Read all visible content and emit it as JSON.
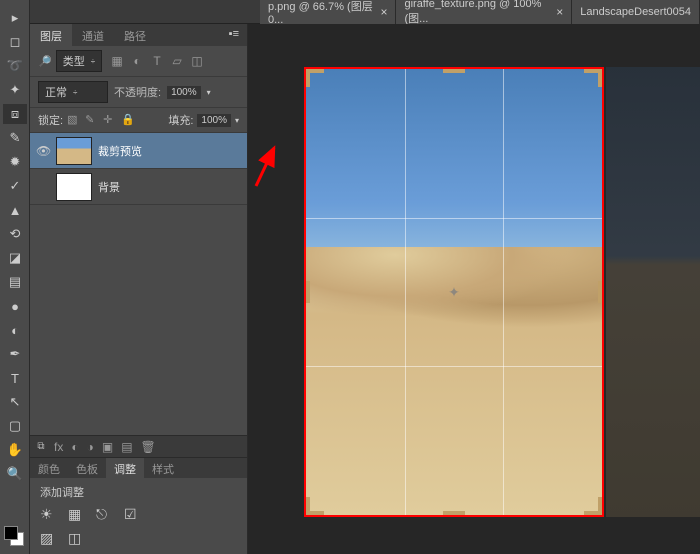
{
  "tabs": [
    {
      "label": "p.png @ 66.7% (图层0..."
    },
    {
      "label": "giraffe_texture.png @ 100% (图..."
    },
    {
      "label": "LandscapeDesert0054"
    }
  ],
  "panel_tabs": {
    "layers": "图层",
    "channels": "通道",
    "paths": "路径"
  },
  "layer_ctrl": {
    "kind_label": "类型",
    "blend_mode": "正常",
    "opacity_label": "不透明度:",
    "opacity_val": "100%",
    "lock_label": "锁定:",
    "fill_label": "填充:",
    "fill_val": "100%"
  },
  "layers": [
    {
      "name": "裁剪预览"
    },
    {
      "name": "背景"
    }
  ],
  "layer_footer": {
    "fx": "fx"
  },
  "adj_tabs": {
    "color": "颜色",
    "swatches": "色板",
    "adjust": "调整",
    "styles": "样式"
  },
  "adj_title": "添加调整"
}
